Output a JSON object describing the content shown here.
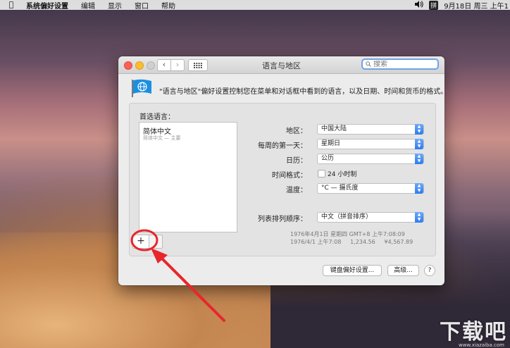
{
  "menubar": {
    "app_name": "系统偏好设置",
    "items": [
      "编辑",
      "显示",
      "窗口",
      "帮助"
    ],
    "input_method": "拼",
    "datetime": "9月18日 周三 上午1"
  },
  "window": {
    "title": "语言与地区",
    "search_placeholder": "搜索",
    "description": "\"语言与地区\"偏好设置控制您在菜单和对话框中看到的语言，以及日期、时间和货币的格式。"
  },
  "preferred_languages": {
    "label": "首选语言：",
    "items": [
      {
        "name": "简体中文",
        "sub": "简体中文 — 主要"
      }
    ]
  },
  "settings": {
    "region": {
      "label": "地区：",
      "value": "中国大陆"
    },
    "first_day": {
      "label": "每周的第一天：",
      "value": "星期日"
    },
    "calendar": {
      "label": "日历：",
      "value": "公历"
    },
    "time_format": {
      "label": "时间格式：",
      "checkbox_label": "24 小时制",
      "checked": false
    },
    "temperature": {
      "label": "温度：",
      "value": "°C — 摄氏度"
    },
    "sort_order": {
      "label": "列表排列顺序：",
      "value": "中文（拼音排序）"
    }
  },
  "sample": {
    "line1": "1976年4月1日 星期四 GMT+8 上午7:08:09",
    "line2": "1976/4/1 上午7:08     1,234.56     ¥4,567.89"
  },
  "buttons": {
    "add": "+",
    "keyboard": "键盘偏好设置...",
    "advanced": "高级...",
    "help": "?"
  },
  "watermark": {
    "text": "下载吧",
    "url": "www.xiazaiba.com"
  },
  "colors": {
    "accent": "#2c7bf2",
    "annotation": "#e8262c"
  }
}
